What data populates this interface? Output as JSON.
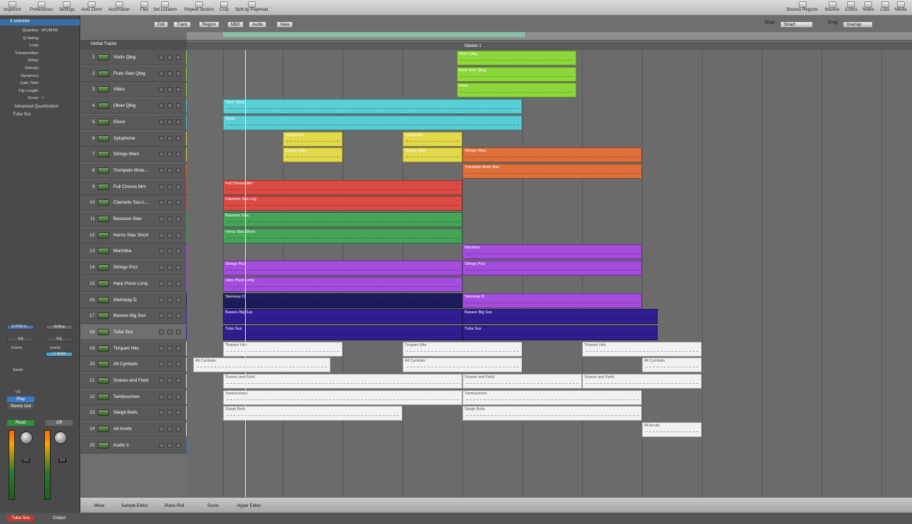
{
  "toolbar": {
    "items": [
      "Inspector",
      "Preferences",
      "Settings",
      "Auto Zoom",
      "Automation",
      "Flex",
      "Set Locators",
      "Repeat Section",
      "Crop",
      "Split by Playhead"
    ],
    "right": [
      "Bounce Regions",
      "Bounce",
      "Colors",
      "Notes",
      "Lists",
      "Media"
    ]
  },
  "inspector": {
    "selected": "3 selected",
    "params": [
      {
        "label": "Quantize:",
        "value": "off (3840)"
      },
      {
        "label": "Q-Swing:",
        "value": ""
      },
      {
        "label": "Loop:",
        "value": ""
      },
      {
        "label": "Transposition:",
        "value": ""
      },
      {
        "label": "Delay:",
        "value": ""
      },
      {
        "label": "Velocity:",
        "value": ""
      },
      {
        "label": "Dynamics:",
        "value": ""
      },
      {
        "label": "Gate Time:",
        "value": ""
      },
      {
        "label": "Clip Length:",
        "value": ""
      },
      {
        "label": "Score:",
        "value": "✓"
      }
    ],
    "advanced": "Advanced Quantization",
    "track": "Tuba Sus",
    "strip1": {
      "plugin": "EVP88 El...",
      "eq": "EQ",
      "inserts": "Inserts",
      "sends": "Sends",
      "io": "I/O",
      "input": "Play",
      "output": "Stereo Out",
      "mode": "Read",
      "fader": "0.0",
      "name": "Tuba Sus"
    },
    "strip2": {
      "plugin": "Setting",
      "eq": "EQ",
      "inserts": "Inserts",
      "insert1": "L1 limiter",
      "mode": "Off",
      "fader": "0.0",
      "name": "Output"
    }
  },
  "localmenu": [
    "Edit",
    "Track",
    "Region",
    "MIDI",
    "Audio",
    "View"
  ],
  "snap": {
    "label": "Snap:",
    "value": "Smart"
  },
  "drag": {
    "label": "Drag:",
    "value": "Overlap"
  },
  "global_tracks": "Global Tracks",
  "marker": "Marker 1",
  "tracks": [
    {
      "num": "1",
      "name": "Violin Qleg",
      "color": "#7fd33a"
    },
    {
      "num": "2",
      "name": "Flute Solo Qleg",
      "color": "#7fd33a"
    },
    {
      "num": "3",
      "name": "Vibes",
      "color": "#7fd33a"
    },
    {
      "num": "4",
      "name": "Oboe Qleg",
      "color": "#45c0c8"
    },
    {
      "num": "5",
      "name": "Glock",
      "color": "#45c0c8"
    },
    {
      "num": "6",
      "name": "Xylophone",
      "color": "#d8cf3c"
    },
    {
      "num": "7",
      "name": "Strings Marc",
      "color": "#d8cf3c"
    },
    {
      "num": "8",
      "name": "Trumpets Mute...",
      "color": "#d66a2f"
    },
    {
      "num": "9",
      "name": "Full Chorus Mm",
      "color": "#d6443f"
    },
    {
      "num": "10",
      "name": "Clarinets Sus-L...",
      "color": "#d6443f"
    },
    {
      "num": "11",
      "name": "Bassoon Stac",
      "color": "#3e9a4f"
    },
    {
      "num": "12",
      "name": "Horns Stac Short",
      "color": "#3e9a4f"
    },
    {
      "num": "13",
      "name": "Marimba",
      "color": "#9a44d6"
    },
    {
      "num": "14",
      "name": "Strings Pizz",
      "color": "#9a44d6"
    },
    {
      "num": "15",
      "name": "Harp Pluck Long",
      "color": "#9a44d6"
    },
    {
      "num": "16",
      "name": "Steinway D",
      "color": "#1e1e6a"
    },
    {
      "num": "17",
      "name": "Basses Big Sus",
      "color": "#3422a8"
    },
    {
      "num": "18",
      "name": "Tuba Sus",
      "color": "#3422a8"
    },
    {
      "num": "19",
      "name": "Timpani Hits",
      "color": "#dddddd"
    },
    {
      "num": "20",
      "name": "All Cymbals",
      "color": "#dddddd"
    },
    {
      "num": "21",
      "name": "Snares and Field",
      "color": "#dddddd"
    },
    {
      "num": "22",
      "name": "Tambourines",
      "color": "#dddddd"
    },
    {
      "num": "23",
      "name": "Sleigh Bells",
      "color": "#dddddd"
    },
    {
      "num": "24",
      "name": "All Anvils",
      "color": "#dddddd"
    },
    {
      "num": "25",
      "name": "Audio 1",
      "color": "#3a6aa0"
    }
  ],
  "regions": [
    {
      "track": 0,
      "start": 3.9,
      "end": 5.9,
      "name": "Violin Qleg",
      "color": "#8cd83a"
    },
    {
      "track": 1,
      "start": 3.9,
      "end": 5.9,
      "name": "Flute Solo Qleg",
      "color": "#8cd83a"
    },
    {
      "track": 2,
      "start": 3.9,
      "end": 5.9,
      "name": "Vibes",
      "color": "#8cd83a"
    },
    {
      "track": 3,
      "start": 0,
      "end": 5,
      "name": "Oboe Qleg",
      "color": "#57cfd4"
    },
    {
      "track": 4,
      "start": 0,
      "end": 5,
      "name": "Glock",
      "color": "#57cfd4"
    },
    {
      "track": 5,
      "start": 1,
      "end": 2,
      "name": "Xylophone",
      "color": "#e2d84a"
    },
    {
      "track": 5,
      "start": 3,
      "end": 4,
      "name": "Xylophone",
      "color": "#e2d84a"
    },
    {
      "track": 6,
      "start": 1,
      "end": 2,
      "name": "Strings Marc",
      "color": "#e2d84a"
    },
    {
      "track": 6,
      "start": 3,
      "end": 4,
      "name": "Strings Marc",
      "color": "#e2d84a"
    },
    {
      "track": 6,
      "start": 4,
      "end": 7,
      "name": "Strings Marc",
      "color": "#e0703a"
    },
    {
      "track": 7,
      "start": 4,
      "end": 7,
      "name": "Trumpets Mute Stac",
      "color": "#e0703a"
    },
    {
      "track": 8,
      "start": 0,
      "end": 4,
      "name": "Full Chorus Mm",
      "color": "#dc4a44"
    },
    {
      "track": 9,
      "start": 0,
      "end": 4,
      "name": "Clarinets Sus-Leg",
      "color": "#dc4a44"
    },
    {
      "track": 10,
      "start": 0,
      "end": 4,
      "name": "Bassoon Stac",
      "color": "#45a556"
    },
    {
      "track": 11,
      "start": 0,
      "end": 4,
      "name": "Horns Stac Short",
      "color": "#45a556"
    },
    {
      "track": 12,
      "start": 4,
      "end": 7,
      "name": "Marimba",
      "color": "#a24ddd"
    },
    {
      "track": 13,
      "start": 0,
      "end": 4,
      "name": "Strings Pizz",
      "color": "#a24ddd"
    },
    {
      "track": 13,
      "start": 4,
      "end": 7,
      "name": "Strings Pizz",
      "color": "#a24ddd"
    },
    {
      "track": 14,
      "start": 0,
      "end": 4,
      "name": "Harp Pluck Long",
      "color": "#a24ddd"
    },
    {
      "track": 15,
      "start": 0,
      "end": 4,
      "name": "Steinway D",
      "color": "#1c1c5c"
    },
    {
      "track": 15,
      "start": 4,
      "end": 7,
      "name": "Steinway D",
      "color": "#a24ddd"
    },
    {
      "track": 16,
      "start": 0,
      "end": 4,
      "name": "Basses Big Sus",
      "color": "#2e1e90"
    },
    {
      "track": 16,
      "start": 4,
      "end": 7.26,
      "name": "Basses Big Sus",
      "color": "#2e1e90"
    },
    {
      "track": 17,
      "start": 0,
      "end": 4,
      "name": "Tuba Sus",
      "color": "#2e1e90"
    },
    {
      "track": 17,
      "start": 4,
      "end": 7.26,
      "name": "Tuba Sus",
      "color": "#2e1e90"
    },
    {
      "track": 18,
      "start": 0,
      "end": 2,
      "name": "Timpani Hits",
      "color": "#f2f2f2"
    },
    {
      "track": 18,
      "start": 3,
      "end": 5,
      "name": "Timpani Hits",
      "color": "#f2f2f2"
    },
    {
      "track": 18,
      "start": 6,
      "end": 8,
      "name": "Timpani Hits",
      "color": "#f2f2f2"
    },
    {
      "track": 19,
      "start": -0.5,
      "end": 1.8,
      "name": "All Cymbals",
      "color": "#f2f2f2"
    },
    {
      "track": 19,
      "start": 3,
      "end": 5,
      "name": "All Cymbals",
      "color": "#f2f2f2"
    },
    {
      "track": 19,
      "start": 7,
      "end": 8,
      "name": "All Cymbals",
      "color": "#f2f2f2"
    },
    {
      "track": 20,
      "start": 0,
      "end": 4,
      "name": "Snares and Field",
      "color": "#f2f2f2"
    },
    {
      "track": 20,
      "start": 4,
      "end": 6,
      "name": "Snares and Field",
      "color": "#f2f2f2"
    },
    {
      "track": 20,
      "start": 6,
      "end": 8,
      "name": "Snares and Field",
      "color": "#f2f2f2"
    },
    {
      "track": 21,
      "start": 0,
      "end": 4,
      "name": "Tambourines",
      "color": "#f2f2f2"
    },
    {
      "track": 21,
      "start": 4,
      "end": 7,
      "name": "Tambourines",
      "color": "#f2f2f2"
    },
    {
      "track": 22,
      "start": 0,
      "end": 3,
      "name": "Sleigh Bells",
      "color": "#f2f2f2"
    },
    {
      "track": 22,
      "start": 4,
      "end": 7,
      "name": "Sleigh Bells",
      "color": "#f2f2f2"
    },
    {
      "track": 23,
      "start": 7,
      "end": 8,
      "name": "All Anvils",
      "color": "#f2f2f2"
    }
  ],
  "bottom": [
    "Mixer",
    "Sample Editor",
    "Piano Roll",
    "Score",
    "Hyper Editor"
  ]
}
